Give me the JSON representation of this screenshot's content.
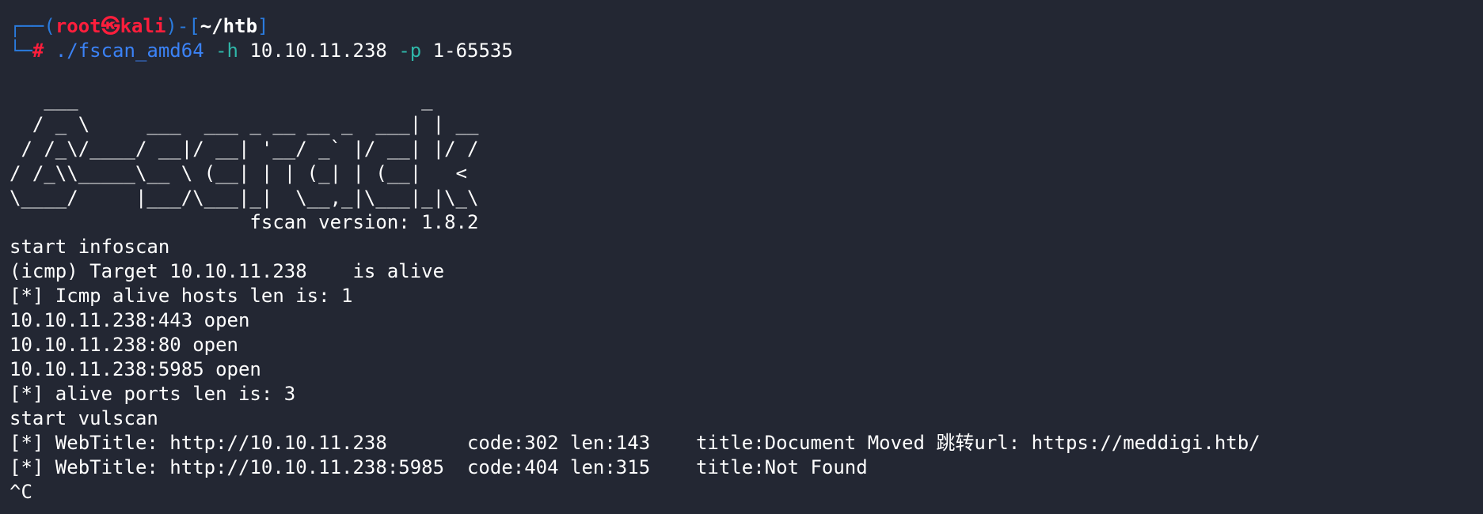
{
  "prompt": {
    "corner_top": "┌──",
    "open_paren": "(",
    "user": "root",
    "skull": "㉿",
    "host": "kali",
    "close_paren": ")",
    "dash": "-",
    "open_bracket": "[",
    "cwd": "~/htb",
    "close_bracket": "]",
    "corner_bottom": "└─",
    "hash": "#",
    "command": "./fscan_amd64",
    "flag_h": "-h",
    "target": "10.10.11.238",
    "flag_p": "-p",
    "ports": "1-65535"
  },
  "banner": {
    "lines": [
      "   ___                              _    ",
      "  / _ \\     ___  ___ _ __ __ _  ___| | __ ",
      " / /_\\/____/ __|/ __| '__/ _` |/ __| |/ /",
      "/ /_\\\\_____\\__ \\ (__| | | (_| | (__|   <    ",
      "\\____/     |___/\\___|_|  \\__,_|\\___|_|\\_\\   "
    ],
    "version": "                     fscan version: 1.8.2"
  },
  "output": [
    "start infoscan",
    "(icmp) Target 10.10.11.238    is alive",
    "[*] Icmp alive hosts len is: 1",
    "10.10.11.238:443 open",
    "10.10.11.238:80 open",
    "10.10.11.238:5985 open",
    "[*] alive ports len is: 3",
    "start vulscan",
    "[*] WebTitle: http://10.10.11.238       code:302 len:143    title:Document Moved 跳转url: https://meddigi.htb/",
    "[*] WebTitle: http://10.10.11.238:5985  code:404 len:315    title:Not Found",
    "^C"
  ]
}
